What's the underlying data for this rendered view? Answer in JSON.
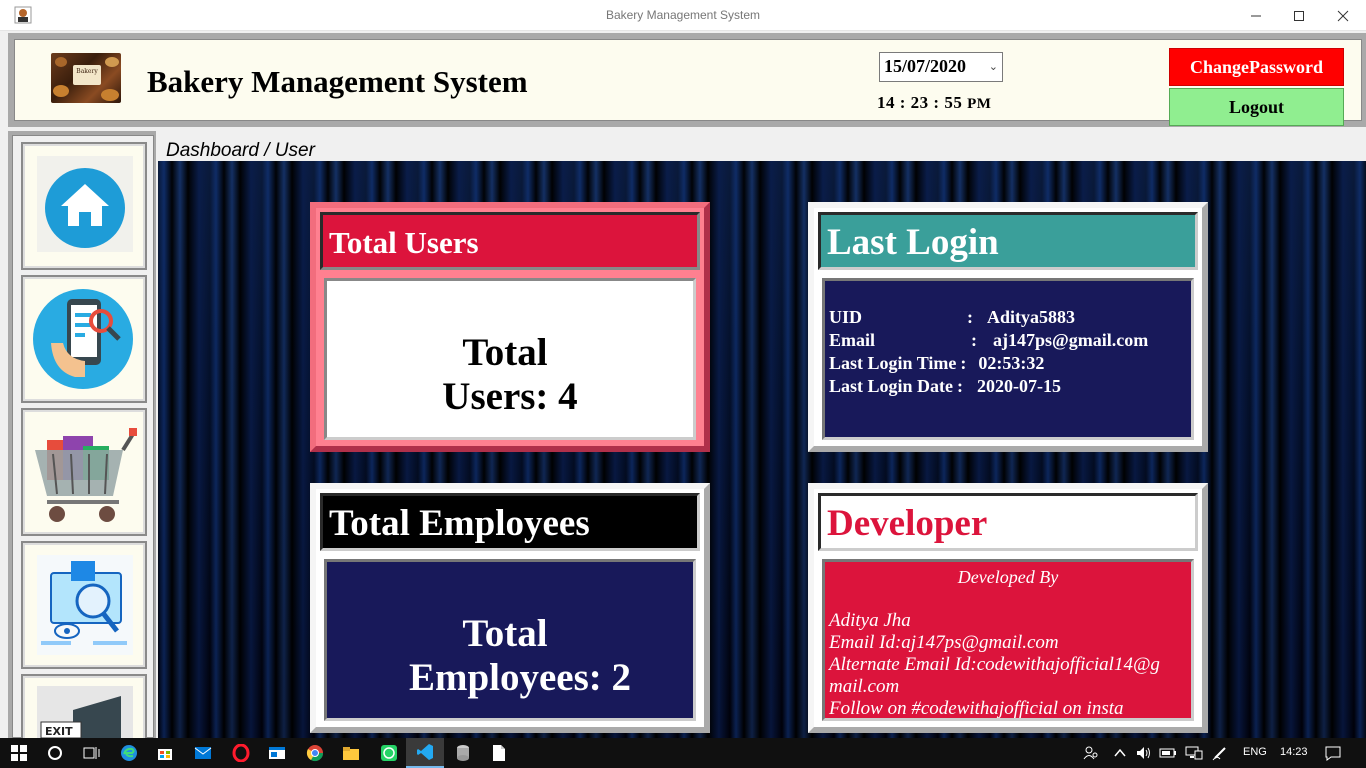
{
  "window": {
    "title": "Bakery Management System"
  },
  "header": {
    "app_title": "Bakery Management System",
    "logo_text": "Bakery",
    "date_value": "15/07/2020",
    "clock": "14 : 23 : 55",
    "clock_ampm": "PM",
    "change_password_label": "ChangePassword",
    "logout_label": "Logout"
  },
  "breadcrumb": "Dashboard / User",
  "sidebar": {
    "items": [
      {
        "name": "home-icon"
      },
      {
        "name": "mobile-search-icon"
      },
      {
        "name": "shopping-cart-icon"
      },
      {
        "name": "product-inspect-icon"
      },
      {
        "name": "exit-icon",
        "label": "EXIT"
      }
    ]
  },
  "cards": {
    "total_users": {
      "title": "Total Users",
      "line1": "Total",
      "line2": "Users: 4"
    },
    "last_login": {
      "title": "Last Login",
      "rows": [
        {
          "key": "UID",
          "sep": ":",
          "value": "Aditya5883"
        },
        {
          "key": "Email",
          "sep": ":",
          "value": "aj147ps@gmail.com"
        },
        {
          "key": "Last Login Time",
          "sep": ":",
          "value": "02:53:32"
        },
        {
          "key": "Last Login Date",
          "sep": ":",
          "value": "2020-07-15"
        }
      ]
    },
    "total_employees": {
      "title": "Total Employees",
      "line1": "Total",
      "line2": "Employees: 2"
    },
    "developer": {
      "title": "Developer",
      "developed_by": "Developed By",
      "name": "Aditya Jha",
      "email": "Email Id:aj147ps@gmail.com",
      "alt_email_line1": "Alternate Email Id:codewithajofficial14@g",
      "alt_email_line2": "mail.com",
      "follow": "Follow on #codewithajofficial on insta"
    }
  },
  "taskbar": {
    "language": "ENG",
    "time": "14:23"
  },
  "colors": {
    "change_password_bg": "#ff0000",
    "logout_bg": "#90ee90",
    "users_head": "#dc143c",
    "login_head": "#3a9f9a",
    "navy_body": "#18195a",
    "crimson": "#dc143c"
  }
}
